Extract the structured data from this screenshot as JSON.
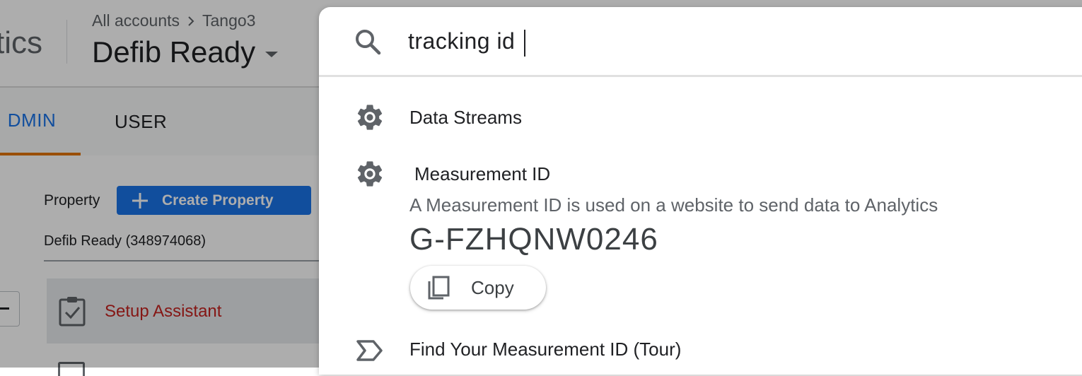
{
  "header": {
    "brand_partial": "tics",
    "breadcrumb": {
      "root": "All accounts",
      "account": "Tango3"
    },
    "property_name": "Defib Ready"
  },
  "tabs": [
    {
      "label": "ADMIN",
      "visible_text": "DMIN",
      "active": true
    },
    {
      "label": "USER",
      "active": false
    }
  ],
  "property_section": {
    "label": "Property",
    "create_button": "Create Property",
    "selected_property": "Defib Ready (348974068)",
    "setup_assistant": "Setup Assistant"
  },
  "search": {
    "query": "tracking id",
    "results": [
      {
        "icon": "gear-icon",
        "title": "Data Streams"
      },
      {
        "icon": "gear-icon",
        "title": "Measurement ID",
        "description": "A Measurement ID is used on a website to send data to Analytics",
        "value": "G-FZHQNW0246",
        "copy_label": "Copy"
      },
      {
        "icon": "tour-icon",
        "title": "Find Your Measurement ID (Tour)"
      }
    ]
  },
  "colors": {
    "accent_blue": "#1a73e8",
    "tab_indicator": "#e37400",
    "setup_red": "#c5221f"
  }
}
